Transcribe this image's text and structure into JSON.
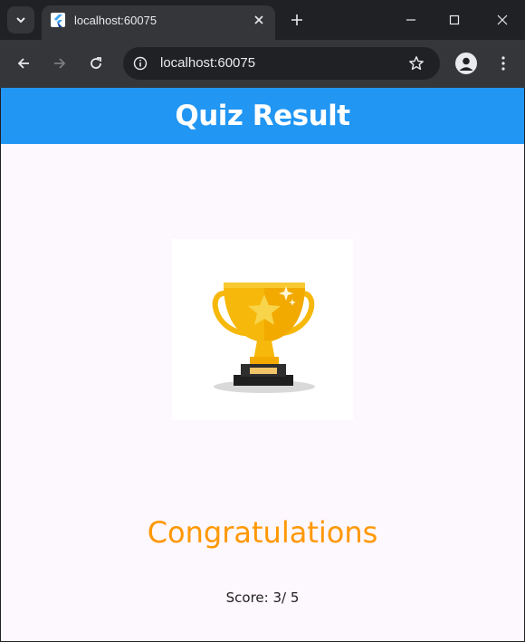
{
  "browser": {
    "tab": {
      "title": "localhost:60075",
      "favicon": "flutter-icon"
    },
    "omnibox": {
      "url": "localhost:60075"
    },
    "icons": {
      "tab_search": "chevron-down-icon",
      "close_tab": "close-icon",
      "new_tab": "plus-icon",
      "minimize": "minimize-icon",
      "maximize": "maximize-icon",
      "close_window": "close-icon",
      "back": "arrow-left-icon",
      "forward": "arrow-right-icon",
      "reload": "reload-icon",
      "site_info": "info-icon",
      "bookmark": "star-icon",
      "profile": "person-icon",
      "menu": "more-vert-icon"
    }
  },
  "app": {
    "appbar_title": "Quiz Result",
    "image": "trophy-icon",
    "congrats": "Congratulations",
    "score": "Score: 3/ 5",
    "colors": {
      "appbar": "#2196f3",
      "congrats": "#ff9800",
      "background": "#fdf7fe"
    }
  }
}
